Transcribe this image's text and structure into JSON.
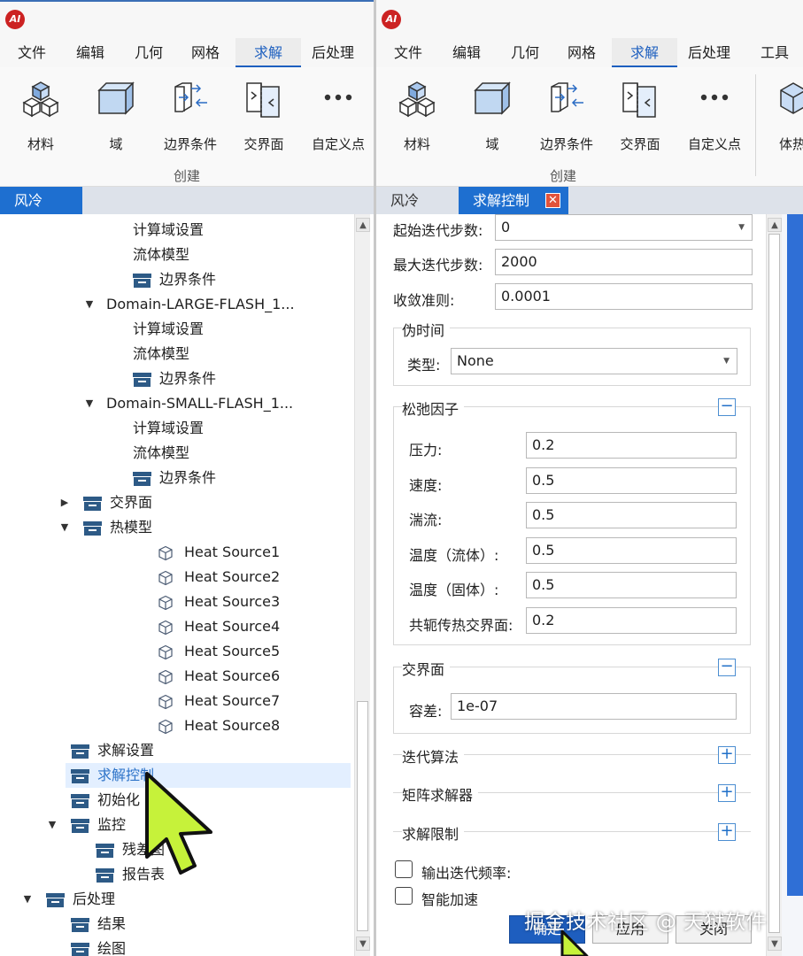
{
  "left": {
    "menu": [
      "文件",
      "编辑",
      "几何",
      "网格",
      "求解",
      "后处理"
    ],
    "active_menu_index": 4,
    "ribbon": [
      "材料",
      "域",
      "边界条件",
      "交界面",
      "自定义点"
    ],
    "group_label": "创建",
    "tab": "风冷",
    "tree": [
      {
        "label": "计算域设置",
        "indent": 3,
        "icon": "none"
      },
      {
        "label": "流体模型",
        "indent": 3,
        "icon": "none"
      },
      {
        "label": "边界条件",
        "indent": 3,
        "icon": "box"
      },
      {
        "label": "Domain-LARGE-FLASH_1...",
        "indent": 2,
        "icon": "none",
        "arrow": "down"
      },
      {
        "label": "计算域设置",
        "indent": 3,
        "icon": "none"
      },
      {
        "label": "流体模型",
        "indent": 3,
        "icon": "none"
      },
      {
        "label": "边界条件",
        "indent": 3,
        "icon": "box"
      },
      {
        "label": "Domain-SMALL-FLASH_1...",
        "indent": 2,
        "icon": "none",
        "arrow": "down"
      },
      {
        "label": "计算域设置",
        "indent": 3,
        "icon": "none"
      },
      {
        "label": "流体模型",
        "indent": 3,
        "icon": "none"
      },
      {
        "label": "边界条件",
        "indent": 3,
        "icon": "box"
      },
      {
        "label": "交界面",
        "indent": 1,
        "icon": "box",
        "arrow": "right"
      },
      {
        "label": "热模型",
        "indent": 1,
        "icon": "box",
        "arrow": "down"
      },
      {
        "label": "Heat Source1",
        "indent": 2,
        "icon": "cube"
      },
      {
        "label": "Heat Source2",
        "indent": 2,
        "icon": "cube"
      },
      {
        "label": "Heat Source3",
        "indent": 2,
        "icon": "cube"
      },
      {
        "label": "Heat Source4",
        "indent": 2,
        "icon": "cube"
      },
      {
        "label": "Heat Source5",
        "indent": 2,
        "icon": "cube"
      },
      {
        "label": "Heat Source6",
        "indent": 2,
        "icon": "cube"
      },
      {
        "label": "Heat Source7",
        "indent": 2,
        "icon": "cube"
      },
      {
        "label": "Heat Source8",
        "indent": 2,
        "icon": "cube"
      },
      {
        "label": "求解设置",
        "indent": 0.5,
        "icon": "box"
      },
      {
        "label": "求解控制",
        "indent": 0.5,
        "icon": "box",
        "selected": true
      },
      {
        "label": "初始化",
        "indent": 0.5,
        "icon": "box"
      },
      {
        "label": "监控",
        "indent": 0.5,
        "icon": "box",
        "arrow": "down"
      },
      {
        "label": "残差图",
        "indent": 1.5,
        "icon": "box"
      },
      {
        "label": "报告表",
        "indent": 1.5,
        "icon": "box"
      },
      {
        "label": "后处理",
        "indent": -0.5,
        "icon": "box",
        "arrow": "down"
      },
      {
        "label": "结果",
        "indent": 0.5,
        "icon": "box"
      },
      {
        "label": "绘图",
        "indent": 0.5,
        "icon": "box"
      }
    ]
  },
  "right": {
    "menu": [
      "文件",
      "编辑",
      "几何",
      "网格",
      "求解",
      "后处理",
      "工具"
    ],
    "active_menu_index": 4,
    "ribbon": [
      "材料",
      "域",
      "边界条件",
      "交界面",
      "自定义点",
      "体热"
    ],
    "group_label": "创建",
    "tabs": [
      "风冷",
      "求解控制"
    ],
    "form": {
      "start_step_label": "起始迭代步数:",
      "start_step_value": "0",
      "max_step_label": "最大迭代步数:",
      "max_step_value": "2000",
      "converge_label": "收敛准则:",
      "converge_value": "0.0001",
      "pseudo_time_title": "伪时间",
      "type_label": "类型:",
      "type_value": "None",
      "relax_title": "松弛因子",
      "relax": [
        {
          "label": "压力:",
          "value": "0.2"
        },
        {
          "label": "速度:",
          "value": "0.5"
        },
        {
          "label": "湍流:",
          "value": "0.5"
        },
        {
          "label": "温度（流体）:",
          "value": "0.5"
        },
        {
          "label": "温度（固体）:",
          "value": "0.5"
        },
        {
          "label": "共轭传热交界面:",
          "value": "0.2"
        }
      ],
      "interface_title": "交界面",
      "tolerance_label": "容差:",
      "tolerance_value": "1e-07",
      "iter_algo_title": "迭代算法",
      "matrix_solver_title": "矩阵求解器",
      "solve_limit_title": "求解限制",
      "output_freq_label": "输出迭代频率:",
      "smart_accel_label": "智能加速",
      "ok_label": "确定",
      "apply_label": "应用",
      "close_label": "关闭"
    }
  },
  "watermark": "掘金技术社区 @ 天狱软件"
}
